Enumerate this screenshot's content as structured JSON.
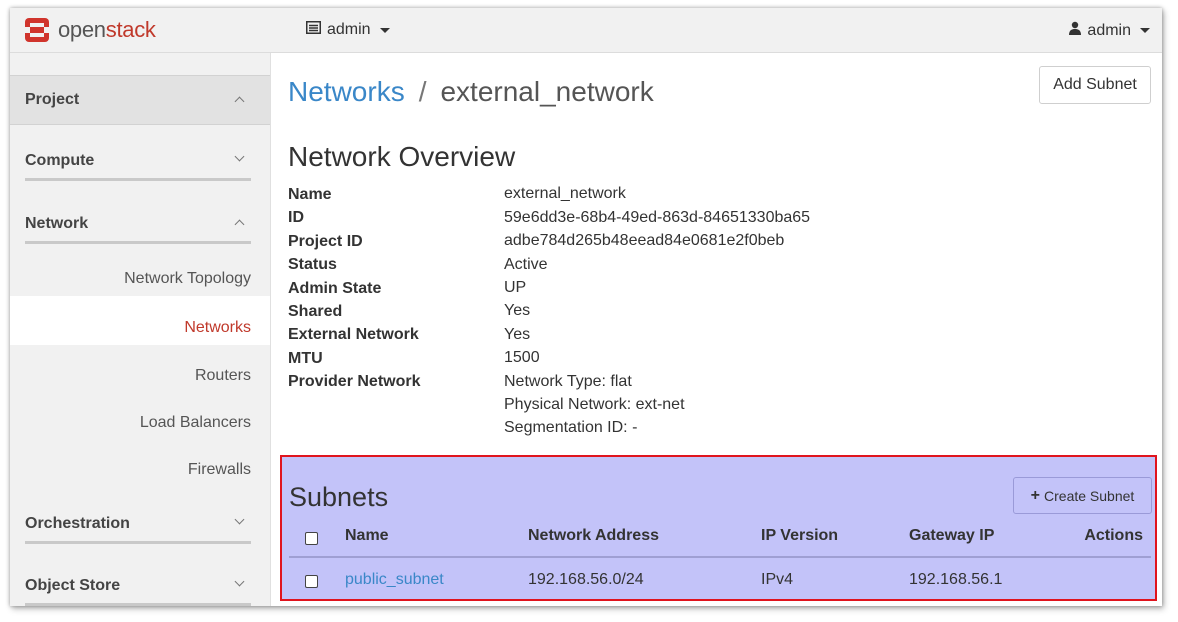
{
  "header": {
    "logo_open": "open",
    "logo_stack": "stack",
    "project_label": "admin",
    "user_label": "admin"
  },
  "sidebar": {
    "sections": [
      {
        "label": "Project",
        "state": "expanded"
      },
      {
        "label": "Compute",
        "state": "collapsed"
      },
      {
        "label": "Network",
        "state": "expanded"
      },
      {
        "label": "Orchestration",
        "state": "collapsed"
      },
      {
        "label": "Object Store",
        "state": "collapsed"
      }
    ],
    "network_items": [
      "Network Topology",
      "Networks",
      "Routers",
      "Load Balancers",
      "Firewalls"
    ],
    "active_item": "Networks"
  },
  "breadcrumb": {
    "parent": "Networks",
    "separator": "/",
    "current": "external_network"
  },
  "actions": {
    "add_subnet": "Add Subnet"
  },
  "overview": {
    "title": "Network Overview",
    "fields": [
      {
        "label": "Name",
        "value": "external_network"
      },
      {
        "label": "ID",
        "value": "59e6dd3e-68b4-49ed-863d-84651330ba65"
      },
      {
        "label": "Project ID",
        "value": "adbe784d265b48eead84e0681e2f0beb"
      },
      {
        "label": "Status",
        "value": "Active"
      },
      {
        "label": "Admin State",
        "value": "UP"
      },
      {
        "label": "Shared",
        "value": "Yes"
      },
      {
        "label": "External Network",
        "value": "Yes"
      },
      {
        "label": "MTU",
        "value": "1500"
      },
      {
        "label": "Provider Network",
        "value": "Network Type: flat"
      }
    ],
    "provider_extra": [
      "Physical Network: ext-net",
      "Segmentation ID: -"
    ]
  },
  "subnets": {
    "title": "Subnets",
    "create_label": "Create Subnet",
    "columns": [
      "Name",
      "Network Address",
      "IP Version",
      "Gateway IP",
      "Actions"
    ],
    "rows": [
      {
        "name": "public_subnet",
        "network_address": "192.168.56.0/24",
        "ip_version": "IPv4",
        "gateway_ip": "192.168.56.1",
        "actions": ""
      }
    ]
  },
  "colors": {
    "accent_red": "#c0392b",
    "link_blue": "#3a87c8",
    "highlight_fill": "#c3c3f9",
    "highlight_border": "#e0141e"
  }
}
